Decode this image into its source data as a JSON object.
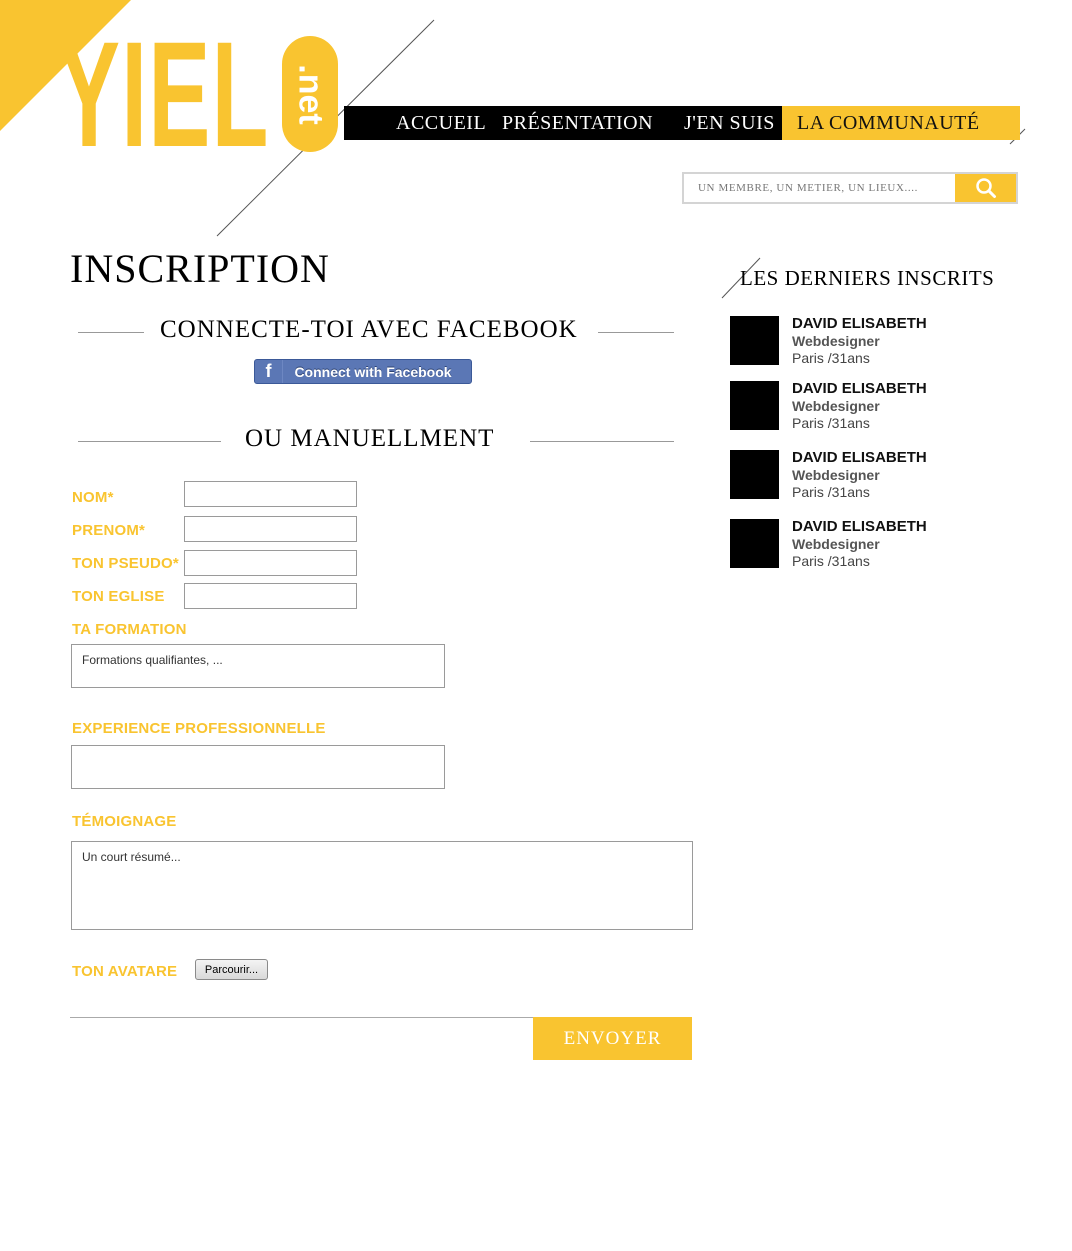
{
  "logo": {
    "text": "YIEL",
    "suffix": ".net"
  },
  "nav": {
    "items": [
      {
        "label": "ACCUEIL"
      },
      {
        "label": "PRÉSENTATION"
      },
      {
        "label": "J'EN SUIS"
      },
      {
        "label": "LA COMMUNAUTÉ"
      }
    ],
    "active_index": 3
  },
  "search": {
    "placeholder": "UN MEMBRE, UN METIER, UN LIEUX....",
    "icon": "search-icon"
  },
  "page": {
    "title": "INSCRIPTION",
    "facebook_heading": "CONNECTE-TOI AVEC FACEBOOK",
    "facebook_button": "Connect with Facebook",
    "manual_heading": "OU MANUELLMENT"
  },
  "form": {
    "nom_label": "NOM*",
    "prenom_label": "PRENOM*",
    "pseudo_label": "TON PSEUDO*",
    "eglise_label": "TON EGLISE",
    "formation_label": "TA FORMATION",
    "formation_placeholder": "Formations qualifiantes, ...",
    "experience_label": "EXPERIENCE PROFESSIONNELLE",
    "temoignage_label": "TÉMOIGNAGE",
    "temoignage_placeholder": "Un court résumé...",
    "avatar_label": "TON  AVATARE",
    "browse_button": "Parcourir...",
    "submit_button": "ENVOYER"
  },
  "sidebar": {
    "title": "LES DERNIERS INSCRITS",
    "members": [
      {
        "name": "DAVID ELISABETH",
        "job": "Webdesigner",
        "location": "Paris /31ans"
      },
      {
        "name": "DAVID ELISABETH",
        "job": "Webdesigner",
        "location": "Paris /31ans"
      },
      {
        "name": "DAVID ELISABETH",
        "job": "Webdesigner",
        "location": "Paris /31ans"
      },
      {
        "name": "DAVID ELISABETH",
        "job": "Webdesigner",
        "location": "Paris /31ans"
      }
    ]
  },
  "colors": {
    "accent": "#f9c430",
    "nav_background": "#000000",
    "facebook": "#5b77b5"
  }
}
